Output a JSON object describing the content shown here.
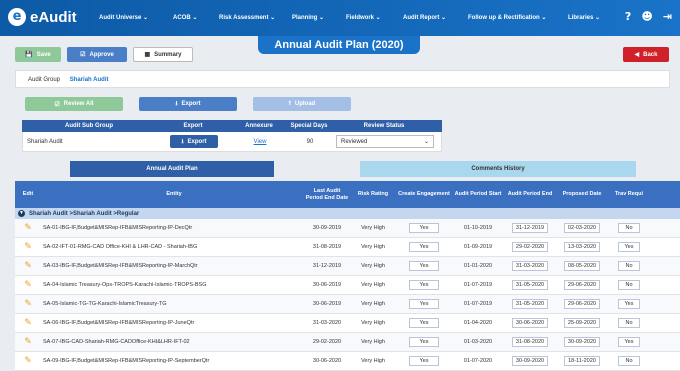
{
  "app": {
    "brand_letter": "e",
    "brand_name": "eAudit"
  },
  "nav": {
    "menu": [
      "Audit Universe ⌄",
      "ACOB ⌄",
      "Risk Assessment ⌄",
      "Planning ⌄",
      "Fieldwork ⌄",
      "Audit Report ⌄",
      "Follow up & Rectification ⌄",
      "Libraries ⌄"
    ],
    "icons": [
      "help-icon",
      "user-icon",
      "logout-icon"
    ]
  },
  "page_title": "Annual Audit Plan (2020)",
  "toolbar": {
    "save": "Save",
    "approve": "Approve",
    "summary": "Summary",
    "back": "Back"
  },
  "audit_group": {
    "label": "Audit Group",
    "value": "Shariah Audit"
  },
  "sub_buttons": {
    "review_all": "Review All",
    "export": "Export",
    "upload": "Upload"
  },
  "subgroup_table": {
    "headers": [
      "Audit Sub Group",
      "Export",
      "Annexure",
      "Special Days",
      "Review Status"
    ],
    "row": {
      "name": "Shariah Audit",
      "export": "Export",
      "annexure": "View",
      "special_days": "90",
      "review_status": "Reviewed"
    }
  },
  "tabs": {
    "active": "Annual Audit Plan",
    "inactive": "Comments History"
  },
  "grid": {
    "headers": [
      "Edit",
      "Entity",
      "Last Audit Period End Date",
      "Risk Rating",
      "Create Engagement",
      "Audit Period Start",
      "Audit Period End",
      "Proposed Date",
      "Trav Requi"
    ],
    "group_label": "Shariah Audit >Shariah Audit >Regular",
    "rows": [
      {
        "entity": "SA-01-IBG-IF,Budget&MISRep-IFB&MISReporting-IP-DecQtr",
        "last": "30-09-2019",
        "risk": "Very High",
        "create": "Yes",
        "start": "01-10-2019",
        "end": "31-12-2019",
        "proposed": "02-03-2020",
        "trav": "No"
      },
      {
        "entity": "SA-02-IFT-01-RMG-CAD Office-KHI & LHR-CAD - Shariah-IBG",
        "last": "31-08-2019",
        "risk": "Very High",
        "create": "Yes",
        "start": "01-09-2019",
        "end": "29-02-2020",
        "proposed": "13-03-2020",
        "trav": "Yes"
      },
      {
        "entity": "SA-03-IBG-IF,Budget&MISRep-IFB&MISReporting-IP-MarchQtr",
        "last": "31-12-2019",
        "risk": "Very High",
        "create": "Yes",
        "start": "01-01-2020",
        "end": "31-03-2020",
        "proposed": "08-05-2020",
        "trav": "No"
      },
      {
        "entity": "SA-04-Islamic Treasury-Ops-TROPS-Karachi-Islamic-TROPS-BSG",
        "last": "30-06-2019",
        "risk": "Very High",
        "create": "Yes",
        "start": "01-07-2019",
        "end": "31-05-2020",
        "proposed": "29-06-2020",
        "trav": "No"
      },
      {
        "entity": "SA-05-Islamic-TG-TG-Karachi-IslamicTreasury-TG",
        "last": "30-06-2019",
        "risk": "Very High",
        "create": "Yes",
        "start": "01-07-2019",
        "end": "31-05-2020",
        "proposed": "29-06-2020",
        "trav": "Yes"
      },
      {
        "entity": "SA-06-IBG-IF,Budget&MISRep-IFB&MISReporting-IP-JuneQtr",
        "last": "31-03-2020",
        "risk": "Very High",
        "create": "Yes",
        "start": "01-04-2020",
        "end": "30-06-2020",
        "proposed": "25-09-2020",
        "trav": "No"
      },
      {
        "entity": "SA-07-IBG-CAD-Shariah-RMG-CADOffice-KHI&LHR-IFT-02",
        "last": "29-02-2020",
        "risk": "Very High",
        "create": "Yes",
        "start": "01-03-2020",
        "end": "31-08-2020",
        "proposed": "30-09-2020",
        "trav": "Yes"
      },
      {
        "entity": "SA-09-IBG-IF,Budget&MISRep-IFB&MISReporting-IP-SeptemberQtr",
        "last": "30-06-2020",
        "risk": "Very High",
        "create": "Yes",
        "start": "01-07-2020",
        "end": "30-09-2020",
        "proposed": "18-11-2020",
        "trav": "No"
      }
    ]
  },
  "colors": {
    "nav": "#1a73c8",
    "header": "#3b6fc0",
    "save": "#8fc99a",
    "back": "#d0202a",
    "pencil": "#f0a020"
  }
}
